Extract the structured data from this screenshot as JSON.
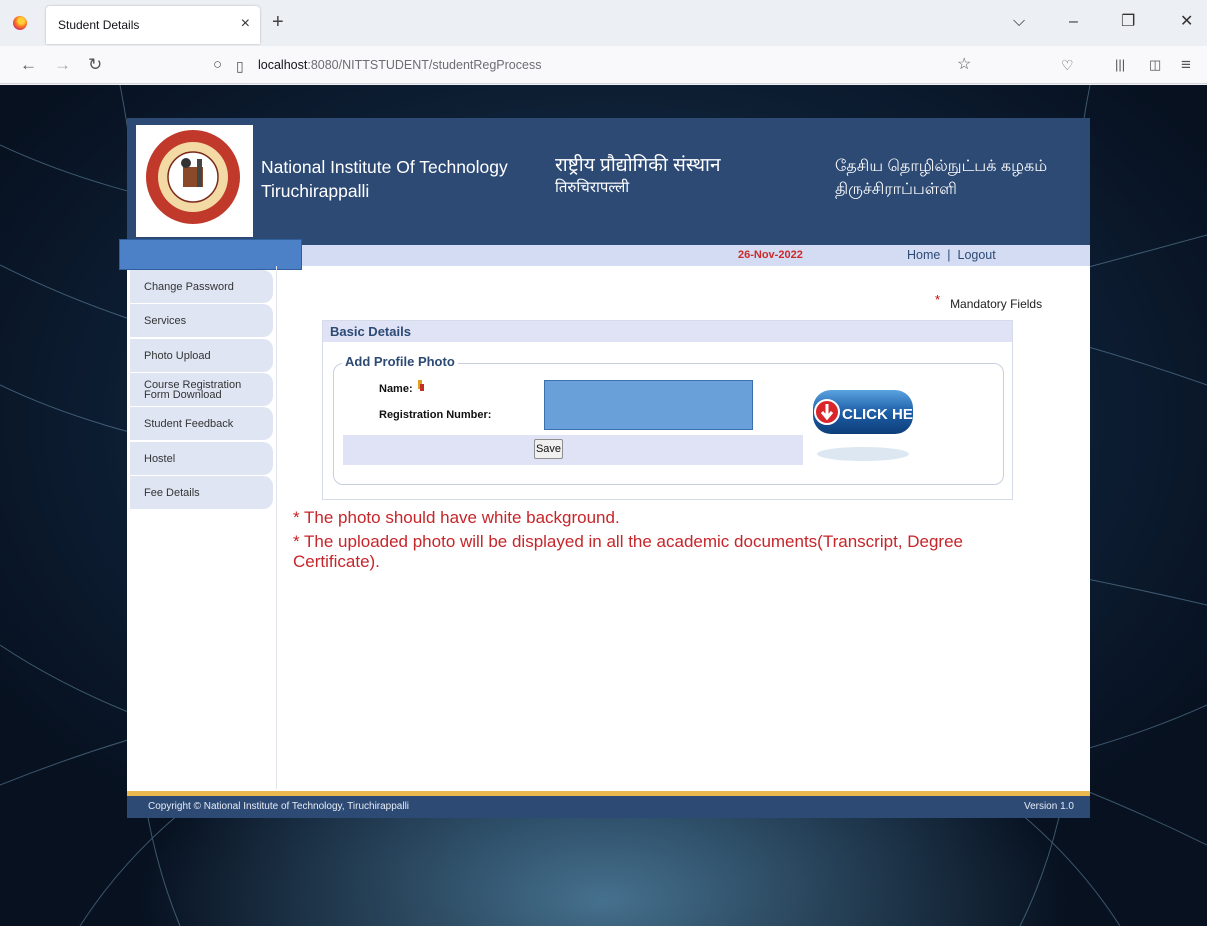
{
  "browser": {
    "tab_title": "Student Details",
    "url_host": "localhost",
    "url_rest": ":8080/NITTSTUDENT/studentRegProcess"
  },
  "header": {
    "english_line1": "National Institute Of Technology",
    "english_line2": "Tiruchirappalli",
    "hindi_line1": "राष्ट्रीय प्रौद्योगिकी संस्थान",
    "hindi_line2": "तिरुचिरापल्ली",
    "tamil_line1": "தேசிய தொழில்நுட்பக் கழகம்",
    "tamil_line2": "திருச்சிராப்பள்ளி"
  },
  "subbar": {
    "date": "26-Nov-2022",
    "home": "Home",
    "separator": "|",
    "logout": "Logout"
  },
  "sidebar": {
    "items": [
      {
        "label": "Change Password"
      },
      {
        "label": "Services"
      },
      {
        "label": "Photo Upload"
      },
      {
        "label": "Course Registration\nForm Download"
      },
      {
        "label": "Student Feedback"
      },
      {
        "label": "Hostel"
      },
      {
        "label": "Fee Details"
      }
    ]
  },
  "form": {
    "mandatory_star": "*",
    "mandatory_text": "Mandatory Fields",
    "section_title": "Basic Details",
    "fieldset_legend": "Add Profile Photo",
    "name_label": "Name:",
    "reg_label": "Registration Number:",
    "save_label": "Save",
    "click_here": "CLICK HERE"
  },
  "notes": {
    "line1": "* The photo should have white background.",
    "line2": "* The uploaded photo will be displayed in all the academic documents(Transcript, Degree",
    "line3": "Certificate)."
  },
  "footer": {
    "copyright": "Copyright © National Institute of Technology, Tiruchirappalli",
    "version": "Version 1.0"
  },
  "colors": {
    "header_bg": "#2d4a75",
    "subbar_bg": "#d4dcf3",
    "note_red": "#c6252a",
    "footer_gold": "#e9b94f"
  }
}
